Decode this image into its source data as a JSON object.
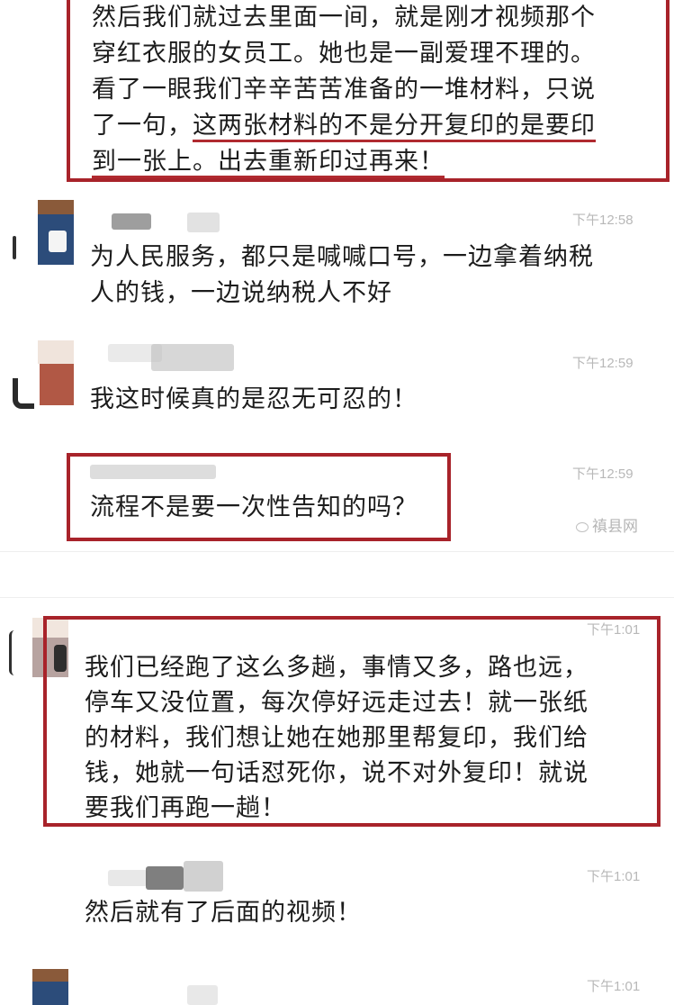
{
  "messages": [
    {
      "id": "m0",
      "lines": [
        "然后我们就过去里面一间，就是刚才视频那个",
        "穿红衣服的女员工。她也是一副爱理不理的。",
        "看了一眼我们辛辛苦苦准备的一堆材料，只说"
      ],
      "line4_plain": "了一句，",
      "line4_underlined": "这两张材料的不是分开复印的是要印",
      "line5_underlined": "到一张上。出去重新印过再来！"
    },
    {
      "id": "m1",
      "time": "下午12:58",
      "lines": [
        "为人民服务，都只是喊喊口号，一边拿着纳税",
        "人的钱，一边说纳税人不好"
      ]
    },
    {
      "id": "m2",
      "time": "下午12:59",
      "lines": [
        "我这时候真的是忍无可忍的！"
      ]
    },
    {
      "id": "m3",
      "time": "下午12:59",
      "lines": [
        "流程不是要一次性告知的吗？"
      ]
    },
    {
      "id": "m4",
      "time": "下午1:01",
      "lines": [
        "我们已经跑了这么多趟，事情又多，路也远，",
        "停车又没位置，每次停好远走过去！就一张纸",
        "的材料，我们想让她在她那里帮复印，我们给",
        "钱，她就一句话怼死你，说不对外复印！就说",
        "要我们再跑一趟！"
      ]
    },
    {
      "id": "m5",
      "time": "下午1:01",
      "lines": [
        "然后就有了后面的视频！"
      ]
    },
    {
      "id": "m6",
      "time": "下午1:01",
      "lines": []
    }
  ],
  "watermark": {
    "text": "禛县网",
    "icon": "wechat-bubble-icon"
  },
  "colors": {
    "highlight_box": "#a8232a",
    "timestamp": "#b8b8b8",
    "text": "#1c1c1c"
  }
}
